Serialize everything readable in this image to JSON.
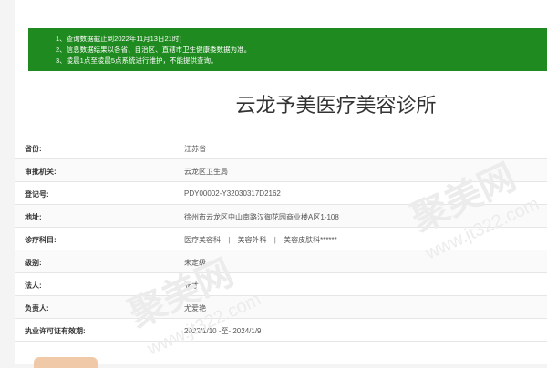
{
  "notice": {
    "lines": [
      "1、查询数据截止到2022年11月13日21时；",
      "2、信息数据结果以各省、自治区、直辖市卫生健康委数据为准。",
      "3、凌晨1点至凌晨5点系统进行维护，不能提供查询。"
    ]
  },
  "title": "云龙予美医疗美容诊所",
  "info": {
    "rows": [
      {
        "label": "省份:",
        "value": "江苏省"
      },
      {
        "label": "审批机关:",
        "value": "云龙区卫生局"
      },
      {
        "label": "登记号:",
        "value": "PDY00002-Y32030317D2162"
      },
      {
        "label": "地址:",
        "value": "徐州市云龙区中山南路汉御花园商业楼A区1-108"
      },
      {
        "label": "诊疗科目:",
        "values": [
          "医疗美容科",
          "美容外科",
          "美容皮肤科******"
        ],
        "separator": "|"
      },
      {
        "label": "级别:",
        "value": "未定级"
      },
      {
        "label": "法人:",
        "value": "张才"
      },
      {
        "label": "负责人:",
        "value": "尤爱艳"
      },
      {
        "label": "执业许可证有效期:",
        "value": "2022/1/10 -至- 2024/1/9"
      }
    ]
  },
  "watermark": {
    "brand": "聚美网",
    "url": "www.jt322.com"
  },
  "colors": {
    "notice_bg": "#1f8a1f",
    "page_bg": "#f4f4f4"
  }
}
